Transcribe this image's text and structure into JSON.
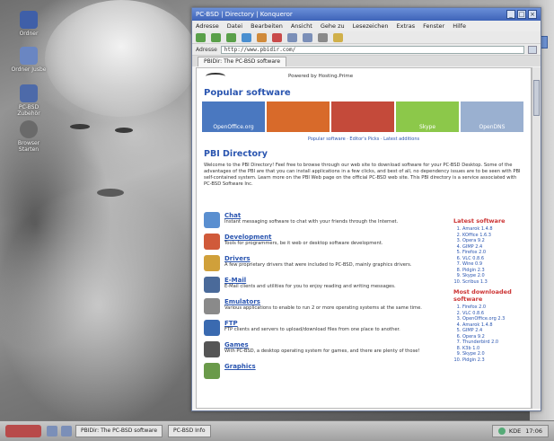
{
  "desktop": {
    "icons": [
      {
        "label": "Ordner",
        "icon": "folder-icon",
        "color": "#3f5fa8"
      },
      {
        "label": "Ordner Jusbe",
        "icon": "folder-icon",
        "color": "#6a86c2"
      },
      {
        "label": "PC-BSD Zubehör",
        "icon": "computer-icon",
        "color": "#4d6aa9"
      },
      {
        "label": "Browser Starten",
        "icon": "globe-icon",
        "color": "#6a6a6a"
      }
    ]
  },
  "window": {
    "title": "PC-BSD | Directory | Konqueror",
    "menu": [
      "Adresse",
      "Datei",
      "Bearbeiten",
      "Ansicht",
      "Gehe zu",
      "Lesezeichen",
      "Extras",
      "Fenster",
      "Hilfe"
    ],
    "url_label": "Adresse",
    "url_value": "http://www.pbidir.com/",
    "tab_label": "PBIDir: The PC-BSD software",
    "toolbar_buttons": [
      {
        "icon": "back-icon",
        "color": "#5aa04a"
      },
      {
        "icon": "forward-icon",
        "color": "#5aa04a"
      },
      {
        "icon": "up-icon",
        "color": "#5aa04a"
      },
      {
        "icon": "reload-icon",
        "color": "#4a8fd0"
      },
      {
        "icon": "home-icon",
        "color": "#d08a3a"
      },
      {
        "icon": "stop-icon",
        "color": "#c94a4a"
      },
      {
        "icon": "zoom-in-icon",
        "color": "#7b8fb8"
      },
      {
        "icon": "zoom-out-icon",
        "color": "#7b8fb8"
      },
      {
        "icon": "print-icon",
        "color": "#8a8a8a"
      },
      {
        "icon": "search-icon",
        "color": "#d0b04a"
      }
    ]
  },
  "page": {
    "tagline": "Powered by Hosting.Prime",
    "popular_title": "Popular software",
    "banners": [
      {
        "label": "OpenOffice.org",
        "color": "#4a78c0"
      },
      {
        "label": "",
        "color": "#d86a2a"
      },
      {
        "label": "",
        "color": "#c44a3a"
      },
      {
        "label": "Skype",
        "color": "#8cc84a"
      },
      {
        "label": "OpenDNS",
        "color": "#9ab0d0"
      }
    ],
    "subnav": "Popular software · Editor's Picks · Latest additions",
    "directory_title": "PBI Directory",
    "intro_text": "Welcome to the PBI Directory! Feel free to browse through our web site to download software for your PC-BSD Desktop. Some of the advantages of the PBI are that you can install applications in a few clicks, and best of all, no dependency issues are to be seen with PBI self-contained system. Learn more on the PBI Web page on the official PC-BSD web site. This PBI directory is a service associated with PC-BSD Software Inc.",
    "categories": [
      {
        "name": "Chat",
        "desc": "Instant messaging software to chat with your friends through the Internet.",
        "icon": "chat-icon",
        "color": "#5a8fd0"
      },
      {
        "name": "Development",
        "desc": "Tools for programmers, be it web or desktop software development.",
        "icon": "development-icon",
        "color": "#d05a3a"
      },
      {
        "name": "Drivers",
        "desc": "A few proprietary drivers that were included to PC-BSD, mainly graphics drivers.",
        "icon": "drivers-icon",
        "color": "#d0a03a"
      },
      {
        "name": "E-Mail",
        "desc": "E-Mail clients and utilities for you to enjoy reading and writing messages.",
        "icon": "email-icon",
        "color": "#4a6a9a"
      },
      {
        "name": "Emulators",
        "desc": "Various applications to enable to run 2 or more operating systems at the same time.",
        "icon": "emulators-icon",
        "color": "#8a8a8a"
      },
      {
        "name": "FTP",
        "desc": "FTP clients and servers to upload/download files from one place to another.",
        "icon": "ftp-icon",
        "color": "#3a6ab0"
      },
      {
        "name": "Games",
        "desc": "With PC-BSD, a desktop operating system for games, and there are plenty of those!",
        "icon": "games-icon",
        "color": "#555555"
      },
      {
        "name": "Graphics",
        "desc": "",
        "icon": "graphics-icon",
        "color": "#6a9a4a"
      }
    ],
    "sidebar": {
      "latest_title": "Latest software",
      "latest": [
        "Amarok 1.4.8",
        "KOffice 1.6.3",
        "Opera 9.2",
        "GIMP 2.4",
        "Firefox 2.0",
        "VLC 0.8.6",
        "Wine 0.9",
        "Pidgin 2.3",
        "Skype 2.0",
        "Scribus 1.3"
      ],
      "downloaded_title": "Most downloaded software",
      "downloaded": [
        "Firefox 2.0",
        "VLC 0.8.6",
        "OpenOffice.org 2.3",
        "Amarok 1.4.8",
        "GIMP 2.4",
        "Opera 9.2",
        "Thunderbird 2.0",
        "K3b 1.0",
        "Skype 2.0",
        "Pidgin 2.3"
      ]
    }
  },
  "taskbar": {
    "tasks": [
      "PBIDir: The PC-BSD software",
      "PC-BSD Info"
    ],
    "tray_text": "KDE",
    "clock": "17:06"
  }
}
